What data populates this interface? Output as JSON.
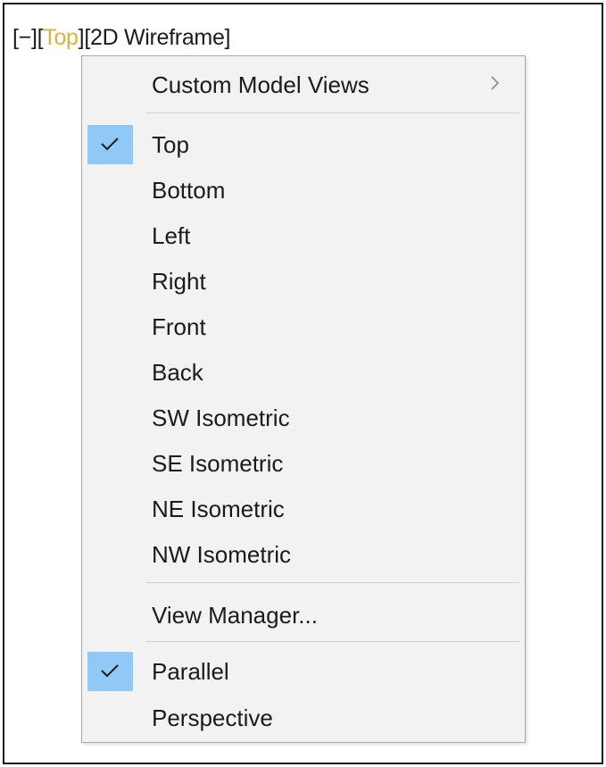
{
  "viewport_controls": {
    "viewport_menu": "[−]",
    "view_open": "[",
    "view": "Top",
    "view_close": "]",
    "visual_style": "[2D Wireframe]",
    "active_color": "#d3b43c"
  },
  "menu": {
    "custom_views": {
      "label": "Custom Model Views",
      "submenu_icon": "chevron-right-icon"
    },
    "views": [
      {
        "label": "Top",
        "checked": true
      },
      {
        "label": "Bottom",
        "checked": false
      },
      {
        "label": "Left",
        "checked": false
      },
      {
        "label": "Right",
        "checked": false
      },
      {
        "label": "Front",
        "checked": false
      },
      {
        "label": "Back",
        "checked": false
      },
      {
        "label": "SW Isometric",
        "checked": false
      },
      {
        "label": "SE Isometric",
        "checked": false
      },
      {
        "label": "NE Isometric",
        "checked": false
      },
      {
        "label": "NW Isometric",
        "checked": false
      }
    ],
    "view_manager": {
      "label": "View Manager..."
    },
    "projection": [
      {
        "label": "Parallel",
        "checked": true
      },
      {
        "label": "Perspective",
        "checked": false
      }
    ],
    "check_icon": "checkmark-icon",
    "highlight_color": "#90c8f6"
  }
}
